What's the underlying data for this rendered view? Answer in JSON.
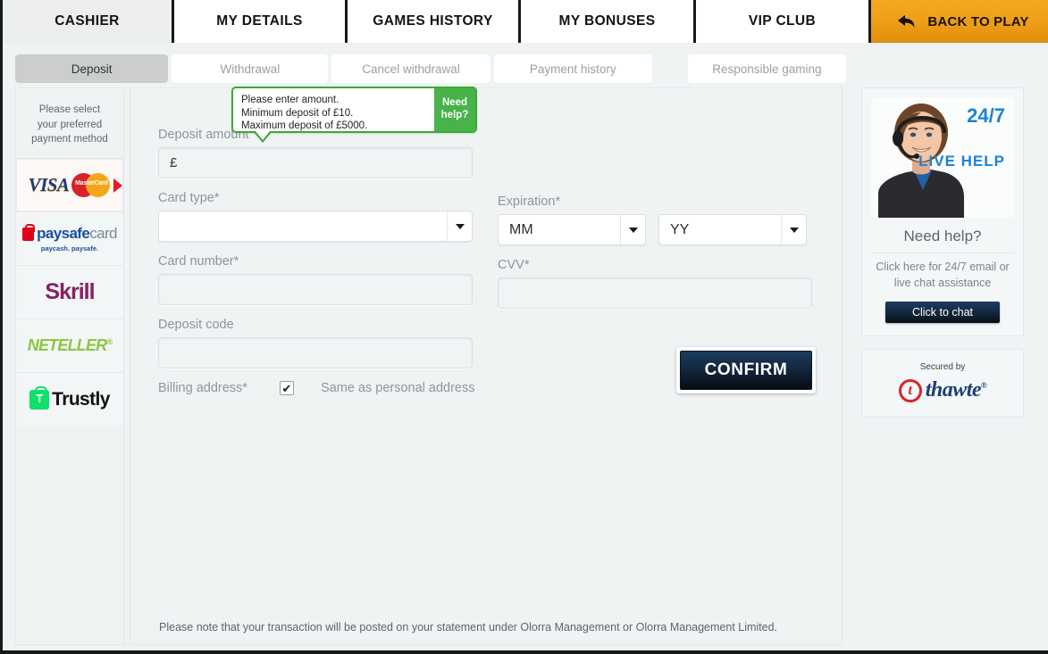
{
  "top_tabs": [
    {
      "label": "CASHIER",
      "active": true
    },
    {
      "label": "MY DETAILS",
      "active": false
    },
    {
      "label": "GAMES HISTORY",
      "active": false
    },
    {
      "label": "MY BONUSES",
      "active": false
    },
    {
      "label": "VIP CLUB",
      "active": false
    }
  ],
  "back_to_play": {
    "label": "BACK TO PLAY",
    "icon": "back-arrow-icon",
    "color": "#eda015"
  },
  "sub_tabs": [
    {
      "label": "Deposit",
      "active": true
    },
    {
      "label": "Withdrawal",
      "active": false
    },
    {
      "label": "Cancel withdrawal",
      "active": false
    },
    {
      "label": "Payment history",
      "active": false
    },
    {
      "label": "Responsible gaming",
      "active": false
    }
  ],
  "payment_sidebar": {
    "hint": "Please select your preferred payment method",
    "methods": [
      {
        "name": "Visa / MasterCard",
        "selected": true,
        "visa_label": "VISA",
        "mc_label": "MasterCard"
      },
      {
        "name": "paysafecard",
        "selected": false,
        "word_a": "paysafe",
        "word_b": "card",
        "tagline": "paycash. paysafe."
      },
      {
        "name": "Skrill",
        "selected": false,
        "label": "Skrill"
      },
      {
        "name": "NETELLER",
        "selected": false,
        "label": "NETELLER"
      },
      {
        "name": "Trustly",
        "selected": false,
        "label": "Trustly"
      }
    ]
  },
  "tooltip": {
    "line1": "Please enter amount.",
    "line2": "Minimum deposit of £10.",
    "line3": "Maximum deposit of £5000.",
    "button_line1": "Need",
    "button_line2": "help?",
    "accent": "#3aaa35"
  },
  "form": {
    "deposit_amount": {
      "label": "Deposit amount",
      "value": "£"
    },
    "card_type": {
      "label": "Card type*",
      "value": ""
    },
    "card_number": {
      "label": "Card number*",
      "value": ""
    },
    "deposit_code": {
      "label": "Deposit code",
      "value": ""
    },
    "expiration": {
      "label": "Expiration*",
      "month_value": "MM",
      "year_value": "YY"
    },
    "cvv": {
      "label": "CVV*",
      "value": ""
    },
    "billing": {
      "label": "Billing address*",
      "checked": "✔",
      "text": "Same as personal address"
    },
    "confirm_label": "CONFIRM"
  },
  "footnote": "Please note that your transaction will be posted on your statement under Olorra Management or Olorra Management Limited.",
  "support": {
    "badge_247": "24/7",
    "badge_live_help": "LIVE  HELP",
    "title": "Need help?",
    "subtitle": "Click here for 24/7 email or live chat assistance",
    "chat_button": "Click to chat",
    "accent": "#1d82d4"
  },
  "seal": {
    "secured_by": "Secured by",
    "brand": "thawte",
    "mark_letter": "t",
    "registered": "®"
  }
}
